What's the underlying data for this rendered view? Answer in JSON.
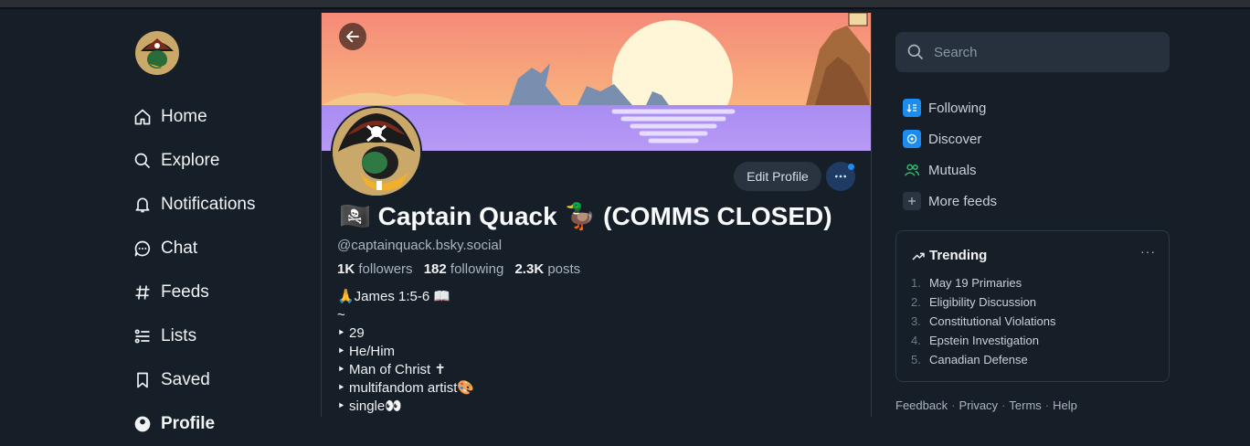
{
  "nav": {
    "items": [
      {
        "label": "Home",
        "icon": "home-icon"
      },
      {
        "label": "Explore",
        "icon": "search-icon"
      },
      {
        "label": "Notifications",
        "icon": "bell-icon"
      },
      {
        "label": "Chat",
        "icon": "chat-icon"
      },
      {
        "label": "Feeds",
        "icon": "hash-icon"
      },
      {
        "label": "Lists",
        "icon": "list-icon"
      },
      {
        "label": "Saved",
        "icon": "bookmark-icon"
      },
      {
        "label": "Profile",
        "icon": "profile-icon"
      }
    ]
  },
  "profile": {
    "display_name": "🏴‍☠️ Captain Quack 🦆 (COMMS CLOSED)",
    "handle": "@captainquack.bsky.social",
    "followers_count": "1K",
    "followers_label": "followers",
    "following_count": "182",
    "following_label": "following",
    "posts_count": "2.3K",
    "posts_label": "posts",
    "edit_label": "Edit Profile",
    "bio_lines": [
      "🙏James 1:5-6 📖",
      "~",
      "‣ 29",
      "‣ He/Him",
      "‣ Man of Christ ✝",
      "‣ multifandom artist🎨",
      "‣ single👀"
    ]
  },
  "search": {
    "placeholder": "Search"
  },
  "feeds": [
    {
      "label": "Following",
      "icon": "following-feed-icon",
      "color": "#1d8cf0"
    },
    {
      "label": "Discover",
      "icon": "discover-feed-icon",
      "color": "#1d8cf0"
    },
    {
      "label": "Mutuals",
      "icon": "mutuals-feed-icon",
      "color": "#2e9e5b"
    },
    {
      "label": "More feeds",
      "icon": "plus-icon",
      "color": "#2a3441"
    }
  ],
  "trending": {
    "title": "Trending",
    "items": [
      {
        "num": "1.",
        "label": "May 19 Primaries"
      },
      {
        "num": "2.",
        "label": "Eligibility Discussion"
      },
      {
        "num": "3.",
        "label": "Constitutional Violations"
      },
      {
        "num": "4.",
        "label": "Epstein Investigation"
      },
      {
        "num": "5.",
        "label": "Canadian Defense"
      }
    ]
  },
  "footer": {
    "links": [
      "Feedback",
      "Privacy",
      "Terms",
      "Help"
    ]
  },
  "colors": {
    "background": "#161e27",
    "accent": "#1d8cf0",
    "banner_sky": "#f4a07a",
    "banner_water": "#b48cf0"
  }
}
